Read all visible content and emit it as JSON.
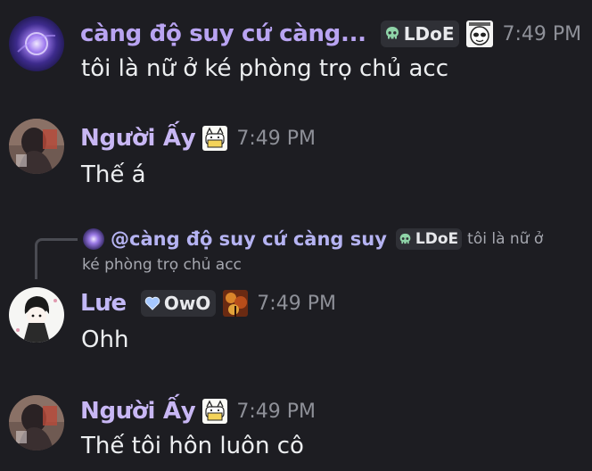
{
  "messages": [
    {
      "username": "càng độ suy cứ càng...",
      "username_color": "#b9a4f2",
      "role_tag": "LDoE",
      "role_icon": "skull-icon",
      "timestamp": "7:49 PM",
      "text": "tôi là nữ ở ké phòng trọ chủ acc"
    },
    {
      "username": "Người Ấy",
      "username_color": "#c8b7f4",
      "timestamp": "7:49 PM",
      "text": "Thế á"
    },
    {
      "reply": {
        "mention": "@càng độ suy cứ càng suy",
        "role_tag": "LDoE",
        "role_icon": "skull-icon",
        "snippet": "tôi là nữ ở",
        "snippet_line2": "ké phòng trọ chủ acc"
      },
      "username": "Lưe",
      "username_color": "#c2b8f6",
      "role_tag": "OwO",
      "role_icon": "heart-icon",
      "timestamp": "7:49 PM",
      "text": "Ohh"
    },
    {
      "username": "Người Ấy",
      "username_color": "#c8b7f4",
      "timestamp": "7:49 PM",
      "text": "Thế tôi hôn luôn cô"
    }
  ]
}
